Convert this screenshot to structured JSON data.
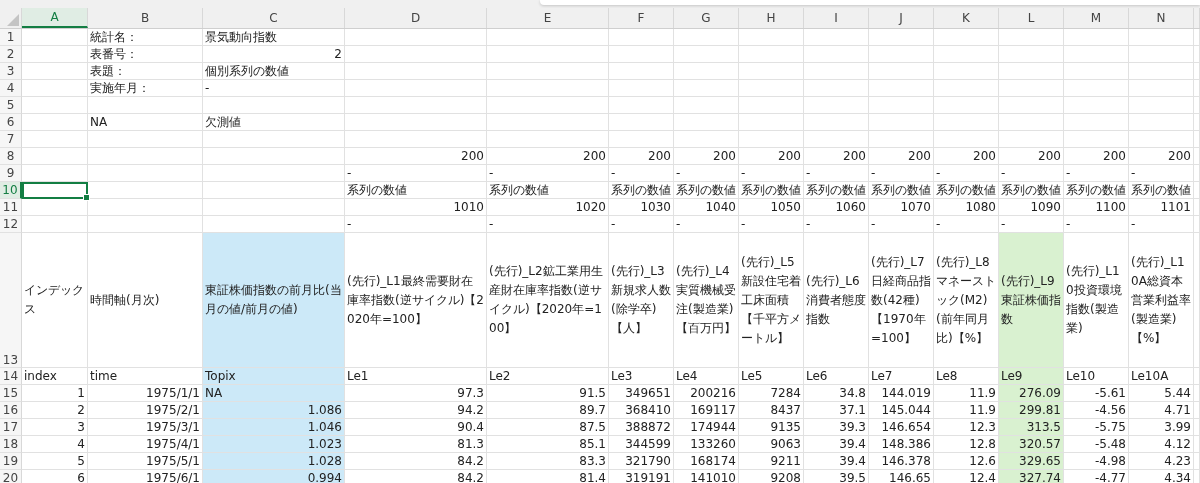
{
  "columns": [
    {
      "letter": "A",
      "selected": true
    },
    {
      "letter": "B",
      "selected": false
    },
    {
      "letter": "C",
      "selected": false
    },
    {
      "letter": "D",
      "selected": false
    },
    {
      "letter": "E",
      "selected": false
    },
    {
      "letter": "F",
      "selected": false
    },
    {
      "letter": "G",
      "selected": false
    },
    {
      "letter": "H",
      "selected": false
    },
    {
      "letter": "I",
      "selected": false
    },
    {
      "letter": "J",
      "selected": false
    },
    {
      "letter": "K",
      "selected": false
    },
    {
      "letter": "L",
      "selected": false
    },
    {
      "letter": "M",
      "selected": false
    },
    {
      "letter": "N",
      "selected": false
    }
  ],
  "rows": [
    {
      "number": "1",
      "selected": false,
      "kind": "plain",
      "cells": [
        null,
        {
          "text": "統計名："
        },
        {
          "text": "景気動向指数"
        }
      ]
    },
    {
      "number": "2",
      "selected": false,
      "kind": "plain",
      "cells": [
        null,
        {
          "text": "表番号："
        },
        {
          "text": "2",
          "right": true
        }
      ]
    },
    {
      "number": "3",
      "selected": false,
      "kind": "plain",
      "cells": [
        null,
        {
          "text": "表題："
        },
        {
          "text": "個別系列の数値"
        }
      ]
    },
    {
      "number": "4",
      "selected": false,
      "kind": "plain",
      "cells": [
        null,
        {
          "text": "実施年月："
        },
        {
          "text": "-"
        }
      ]
    },
    {
      "number": "5",
      "selected": false,
      "kind": "plain"
    },
    {
      "number": "6",
      "selected": false,
      "kind": "plain",
      "cells": [
        null,
        {
          "text": "NA"
        },
        {
          "text": "欠測値"
        }
      ]
    },
    {
      "number": "7",
      "selected": false,
      "kind": "plain"
    },
    {
      "number": "8",
      "selected": false,
      "kind": "plain",
      "cells": [
        null,
        null,
        null,
        {
          "text": "200",
          "right": true
        },
        {
          "text": "200",
          "right": true
        },
        {
          "text": "200",
          "right": true
        },
        {
          "text": "200",
          "right": true
        },
        {
          "text": "200",
          "right": true
        },
        {
          "text": "200",
          "right": true
        },
        {
          "text": "200",
          "right": true
        },
        {
          "text": "200",
          "right": true
        },
        {
          "text": "200",
          "right": true
        },
        {
          "text": "200",
          "right": true
        },
        {
          "text": "200",
          "right": true
        }
      ]
    },
    {
      "number": "9",
      "selected": false,
      "kind": "plain",
      "cells": [
        null,
        null,
        null,
        {
          "text": "-"
        },
        {
          "text": "-"
        },
        {
          "text": "-"
        },
        {
          "text": "-"
        },
        {
          "text": "-"
        },
        {
          "text": "-"
        },
        {
          "text": "-"
        },
        {
          "text": "-"
        },
        {
          "text": "-"
        },
        {
          "text": "-"
        },
        {
          "text": "-"
        }
      ]
    },
    {
      "number": "10",
      "selected": true,
      "kind": "plain",
      "cells": [
        null,
        null,
        null,
        {
          "text": "系列の数値"
        },
        {
          "text": "系列の数値"
        },
        {
          "text": "系列の数値"
        },
        {
          "text": "系列の数値"
        },
        {
          "text": "系列の数値"
        },
        {
          "text": "系列の数値"
        },
        {
          "text": "系列の数値"
        },
        {
          "text": "系列の数値"
        },
        {
          "text": "系列の数値"
        },
        {
          "text": "系列の数値"
        },
        {
          "text": "系列の数値"
        }
      ]
    },
    {
      "number": "11",
      "selected": false,
      "kind": "plain",
      "cells": [
        null,
        null,
        null,
        {
          "text": "1010",
          "right": true
        },
        {
          "text": "1020",
          "right": true
        },
        {
          "text": "1030",
          "right": true
        },
        {
          "text": "1040",
          "right": true
        },
        {
          "text": "1050",
          "right": true
        },
        {
          "text": "1060",
          "right": true
        },
        {
          "text": "1070",
          "right": true
        },
        {
          "text": "1080",
          "right": true
        },
        {
          "text": "1090",
          "right": true
        },
        {
          "text": "1100",
          "right": true
        },
        {
          "text": "1101",
          "right": true
        }
      ]
    },
    {
      "number": "12",
      "selected": false,
      "kind": "plain",
      "cells": [
        null,
        null,
        null,
        {
          "text": "-"
        },
        {
          "text": "-"
        },
        {
          "text": "-"
        },
        {
          "text": "-"
        },
        {
          "text": "-"
        },
        {
          "text": "-"
        },
        {
          "text": "-"
        },
        {
          "text": "-"
        },
        {
          "text": "-"
        },
        {
          "text": "-"
        },
        {
          "text": "-"
        }
      ]
    },
    {
      "number": "13",
      "selected": false,
      "kind": "tall",
      "cells": [
        {
          "text": "インデックス"
        },
        {
          "text": "時間軸(月次)"
        },
        {
          "text": "東証株価指数の前月比(当月の値/前月の値)",
          "color": "#cce9f8"
        },
        {
          "text": "(先行)_L1最終需要財在庫率指数(逆サイクル)【2020年=100】"
        },
        {
          "text": "(先行)_L2鉱工業用生産財在庫率指数(逆サイクル)【2020年=100】"
        },
        {
          "text": "(先行)_L3新規求人数(除学卒)【人】"
        },
        {
          "text": "(先行)_L4実質機械受注(製造業)【百万円】"
        },
        {
          "text": "(先行)_L5新設住宅着工床面積【千平方メートル】"
        },
        {
          "text": "(先行)_L6消費者態度指数"
        },
        {
          "text": "(先行)_L7日経商品指数(42種)【1970年=100】"
        },
        {
          "text": "(先行)_L8マネーストック(M2)(前年同月比)【%】"
        },
        {
          "text": "(先行)_L9東証株価指数",
          "color": "#d9f1d0"
        },
        {
          "text": "(先行)_L10投資環境指数(製造業)"
        },
        {
          "text": "(先行)_L10A総資本営業利益率(製造業)【%】"
        }
      ]
    },
    {
      "number": "14",
      "selected": false,
      "kind": "plain",
      "cells": [
        {
          "text": "index"
        },
        {
          "text": "time"
        },
        {
          "text": "Topix",
          "color": "#cce9f8"
        },
        {
          "text": "Le1"
        },
        {
          "text": "Le2"
        },
        {
          "text": "Le3"
        },
        {
          "text": "Le4"
        },
        {
          "text": "Le5"
        },
        {
          "text": "Le6"
        },
        {
          "text": "Le7"
        },
        {
          "text": "Le8"
        },
        {
          "text": "Le9",
          "color": "#d9f1d0"
        },
        {
          "text": "Le10"
        },
        {
          "text": "Le10A"
        }
      ]
    },
    {
      "number": "15",
      "selected": false,
      "kind": "plain",
      "cells": [
        {
          "text": "1",
          "right": true
        },
        {
          "text": "1975/1/1",
          "right": true
        },
        {
          "text": "NA",
          "color": "#cce9f8"
        },
        {
          "text": "97.3",
          "right": true
        },
        {
          "text": "91.5",
          "right": true
        },
        {
          "text": "349651",
          "right": true
        },
        {
          "text": "200216",
          "right": true
        },
        {
          "text": "7284",
          "right": true
        },
        {
          "text": "34.8",
          "right": true
        },
        {
          "text": "144.019",
          "right": true
        },
        {
          "text": "11.9",
          "right": true
        },
        {
          "text": "276.09",
          "right": true,
          "color": "#d9f1d0"
        },
        {
          "text": "-5.61",
          "right": true
        },
        {
          "text": "5.44",
          "right": true
        }
      ]
    },
    {
      "number": "16",
      "selected": false,
      "kind": "plain",
      "cells": [
        {
          "text": "2",
          "right": true
        },
        {
          "text": "1975/2/1",
          "right": true
        },
        {
          "text": "1.086",
          "right": true,
          "color": "#cce9f8"
        },
        {
          "text": "94.2",
          "right": true
        },
        {
          "text": "89.7",
          "right": true
        },
        {
          "text": "368410",
          "right": true
        },
        {
          "text": "169117",
          "right": true
        },
        {
          "text": "8437",
          "right": true
        },
        {
          "text": "37.1",
          "right": true
        },
        {
          "text": "145.044",
          "right": true
        },
        {
          "text": "11.9",
          "right": true
        },
        {
          "text": "299.81",
          "right": true,
          "color": "#d9f1d0"
        },
        {
          "text": "-4.56",
          "right": true
        },
        {
          "text": "4.71",
          "right": true
        }
      ]
    },
    {
      "number": "17",
      "selected": false,
      "kind": "plain",
      "cells": [
        {
          "text": "3",
          "right": true
        },
        {
          "text": "1975/3/1",
          "right": true
        },
        {
          "text": "1.046",
          "right": true,
          "color": "#cce9f8"
        },
        {
          "text": "90.4",
          "right": true
        },
        {
          "text": "87.5",
          "right": true
        },
        {
          "text": "388872",
          "right": true
        },
        {
          "text": "174944",
          "right": true
        },
        {
          "text": "9135",
          "right": true
        },
        {
          "text": "39.3",
          "right": true
        },
        {
          "text": "146.654",
          "right": true
        },
        {
          "text": "12.3",
          "right": true
        },
        {
          "text": "313.5",
          "right": true,
          "color": "#d9f1d0"
        },
        {
          "text": "-5.75",
          "right": true
        },
        {
          "text": "3.99",
          "right": true
        }
      ]
    },
    {
      "number": "18",
      "selected": false,
      "kind": "plain",
      "cells": [
        {
          "text": "4",
          "right": true
        },
        {
          "text": "1975/4/1",
          "right": true
        },
        {
          "text": "1.023",
          "right": true,
          "color": "#cce9f8"
        },
        {
          "text": "81.3",
          "right": true
        },
        {
          "text": "85.1",
          "right": true
        },
        {
          "text": "344599",
          "right": true
        },
        {
          "text": "133260",
          "right": true
        },
        {
          "text": "9063",
          "right": true
        },
        {
          "text": "39.4",
          "right": true
        },
        {
          "text": "148.386",
          "right": true
        },
        {
          "text": "12.8",
          "right": true
        },
        {
          "text": "320.57",
          "right": true,
          "color": "#d9f1d0"
        },
        {
          "text": "-5.48",
          "right": true
        },
        {
          "text": "4.12",
          "right": true
        }
      ]
    },
    {
      "number": "19",
      "selected": false,
      "kind": "plain",
      "cells": [
        {
          "text": "5",
          "right": true
        },
        {
          "text": "1975/5/1",
          "right": true
        },
        {
          "text": "1.028",
          "right": true,
          "color": "#cce9f8"
        },
        {
          "text": "84.2",
          "right": true
        },
        {
          "text": "83.3",
          "right": true
        },
        {
          "text": "321790",
          "right": true
        },
        {
          "text": "168174",
          "right": true
        },
        {
          "text": "9211",
          "right": true
        },
        {
          "text": "39.4",
          "right": true
        },
        {
          "text": "146.378",
          "right": true
        },
        {
          "text": "12.6",
          "right": true
        },
        {
          "text": "329.65",
          "right": true,
          "color": "#d9f1d0"
        },
        {
          "text": "-4.98",
          "right": true
        },
        {
          "text": "4.23",
          "right": true
        }
      ]
    },
    {
      "number": "20",
      "selected": false,
      "kind": "plain",
      "cells": [
        {
          "text": "6",
          "right": true
        },
        {
          "text": "1975/6/1",
          "right": true
        },
        {
          "text": "0.994",
          "right": true,
          "color": "#cce9f8"
        },
        {
          "text": "84.2",
          "right": true
        },
        {
          "text": "81.4",
          "right": true
        },
        {
          "text": "319191",
          "right": true
        },
        {
          "text": "141010",
          "right": true
        },
        {
          "text": "9208",
          "right": true
        },
        {
          "text": "39.5",
          "right": true
        },
        {
          "text": "146.65",
          "right": true
        },
        {
          "text": "12.4",
          "right": true
        },
        {
          "text": "327.74",
          "right": true,
          "color": "#d9f1d0"
        },
        {
          "text": "-4.77",
          "right": true
        },
        {
          "text": "4.34",
          "right": true
        }
      ]
    }
  ]
}
